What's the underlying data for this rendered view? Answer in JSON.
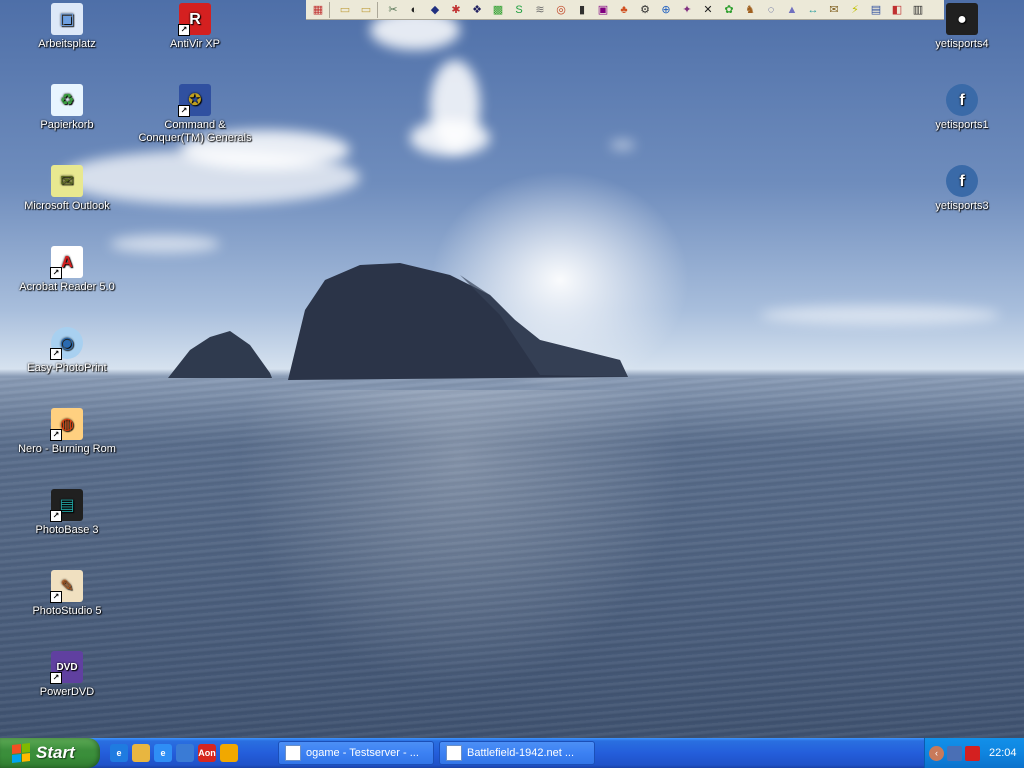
{
  "desktop": {
    "icons_left": [
      {
        "label": "Arbeitsplatz",
        "icon": "computer-icon",
        "shortcut": false
      },
      {
        "label": "Papierkorb",
        "icon": "recycle-bin-icon",
        "shortcut": false
      },
      {
        "label": "Microsoft Outlook",
        "icon": "outlook-icon",
        "shortcut": false
      },
      {
        "label": "Acrobat Reader 5.0",
        "icon": "acrobat-icon",
        "shortcut": true
      },
      {
        "label": "Easy-PhotoPrint",
        "icon": "photoprint-icon",
        "shortcut": true
      },
      {
        "label": "Nero - Burning Rom",
        "icon": "nero-icon",
        "shortcut": true
      },
      {
        "label": "PhotoBase 3",
        "icon": "photobase-icon",
        "shortcut": true
      },
      {
        "label": "PhotoStudio 5",
        "icon": "photostudio-icon",
        "shortcut": true
      },
      {
        "label": "PowerDVD",
        "icon": "powerdvd-icon",
        "shortcut": true
      }
    ],
    "icons_col2": [
      {
        "label": "AntiVir XP",
        "icon": "antivir-icon",
        "shortcut": true
      },
      {
        "label": "Command & Conquer(TM) Generals",
        "icon": "command-conquer-icon",
        "shortcut": true
      }
    ],
    "icons_right": [
      {
        "label": "yetisports4",
        "icon": "penguin-icon"
      },
      {
        "label": "yetisports1",
        "icon": "flash-icon"
      },
      {
        "label": "yetisports3",
        "icon": "flash-icon"
      }
    ]
  },
  "toolbar": {
    "buttons": [
      "app-1",
      "folder-icon",
      "folder-icon",
      "tool-1",
      "tool-2",
      "tool-3",
      "tool-4",
      "tool-5",
      "tool-6",
      "tool-7",
      "tool-8",
      "tool-9",
      "tool-10",
      "tool-11",
      "tool-12",
      "tool-13",
      "tool-14",
      "tool-15",
      "tool-16",
      "tool-17",
      "tool-18",
      "tool-19",
      "tool-20",
      "tool-21",
      "tool-22",
      "tool-23",
      "tool-24",
      "tool-25",
      "tool-26"
    ]
  },
  "taskbar": {
    "start_label": "Start",
    "quick_launch": [
      {
        "name": "ie-icon",
        "text": "e",
        "color": "#1f7be0"
      },
      {
        "name": "folder-icon",
        "text": "",
        "color": "#e8b640"
      },
      {
        "name": "ie-icon",
        "text": "e",
        "color": "#2f8ef5"
      },
      {
        "name": "phone-icon",
        "text": "",
        "color": "#3a7bd5"
      },
      {
        "name": "aon-icon",
        "text": "Aon",
        "color": "#d6261f"
      },
      {
        "name": "media-player-icon",
        "text": "",
        "color": "#f1a800"
      }
    ],
    "tasks": [
      {
        "label": "ogame - Testserver - ...",
        "name": "task-ogame"
      },
      {
        "label": "Battlefield-1942.net ...",
        "name": "task-battlefield"
      }
    ],
    "tray": {
      "clock": "22:04"
    }
  }
}
